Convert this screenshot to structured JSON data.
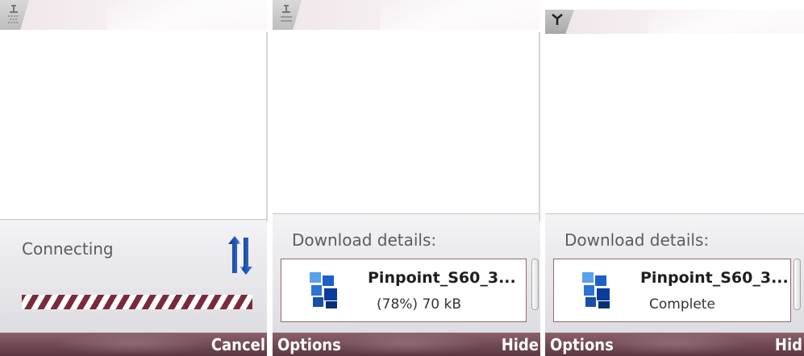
{
  "screens": [
    {
      "panel_title": "Connecting",
      "right_softkey": "Cancel"
    },
    {
      "panel_title": "Download details:",
      "file_name": "Pinpoint_S60_3...",
      "status": "(78%) 70 kB",
      "left_softkey": "Options",
      "right_softkey": "Hide"
    },
    {
      "panel_title": "Download details:",
      "file_name": "Pinpoint_S60_3...",
      "status": "Complete",
      "left_softkey": "Options",
      "right_softkey": "Hid"
    }
  ],
  "colors": {
    "softkey_bar": "#6f4852",
    "progress_stripe": "#7a2a3d",
    "card_border": "#8d6a70"
  }
}
